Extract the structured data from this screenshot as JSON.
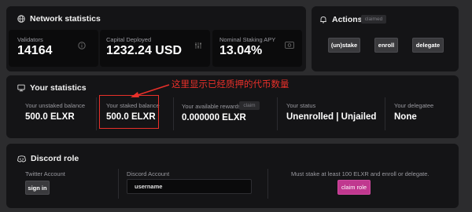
{
  "network": {
    "title": "Network statistics",
    "validators": {
      "label": "Validators",
      "value": "14164"
    },
    "capital": {
      "label": "Capital Deployed",
      "value": "1232.24 USD"
    },
    "apy": {
      "label": "Nominal Staking APY",
      "value": "13.04%"
    }
  },
  "actions": {
    "title": "Actions",
    "badge": "claimed",
    "buttons": {
      "unstake": "(un)stake",
      "enroll": "enroll",
      "delegate": "delegate"
    }
  },
  "your_stats": {
    "title": "Your statistics",
    "unstaked": {
      "label": "Your unstaked balance",
      "value": "500.0 ELXR"
    },
    "staked": {
      "label": "Your staked balance",
      "value": "500.0 ELXR"
    },
    "rewards": {
      "label": "Your available rewards",
      "badge": "claim",
      "value": "0.000000 ELXR"
    },
    "status": {
      "label": "Your status",
      "value": "Unenrolled | Unjailed"
    },
    "delegatee": {
      "label": "Your delegatee",
      "value": "None"
    }
  },
  "annotation": {
    "text": "这里显示已经质押的代币数量",
    "color": "#e8302a"
  },
  "discord": {
    "title": "Discord role",
    "twitter_label": "Twitter Account",
    "sign_in": "sign in",
    "discord_label": "Discord Account",
    "username_value": "username",
    "notice": "Must stake at least 100 ELXR and enroll or delegate.",
    "claim_role": "claim role"
  },
  "colors": {
    "accent_pink": "#c0388f",
    "background": "#2c2c2e",
    "panel": "#141416"
  },
  "icons": {
    "network": "globe-icon",
    "info": "info-icon",
    "sliders": "sliders-icon",
    "money": "money-icon",
    "actions": "bell-icon",
    "stats": "monitor-icon",
    "discord": "discord-icon"
  }
}
